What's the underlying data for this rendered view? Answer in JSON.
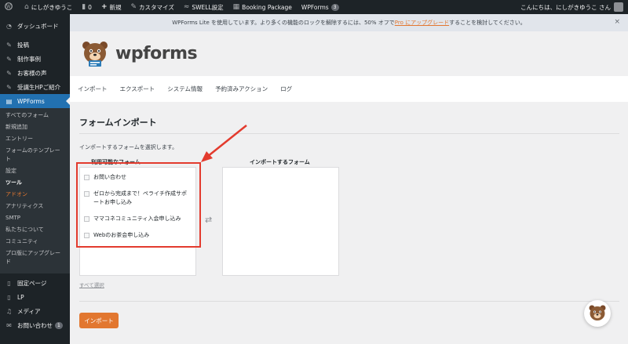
{
  "adminbar": {
    "site_name": "にしがきゆうこ",
    "comments_count": "0",
    "new_label": "新規",
    "customize_label": "カスタマイズ",
    "swell_label": "SWELL設定",
    "booking_label": "Booking Package",
    "wpforms_label": "WPForms",
    "wpforms_badge": "3",
    "greeting": "こんにちは、にしがきゆうこ さん"
  },
  "sidebar": {
    "items": [
      {
        "label": "ダッシュボード",
        "icon": "dashboard-icon"
      },
      {
        "label": "投稿",
        "icon": "pin-icon"
      },
      {
        "label": "制作事例",
        "icon": "pin-icon"
      },
      {
        "label": "お客様の声",
        "icon": "pin-icon"
      },
      {
        "label": "受講生HPご紹介",
        "icon": "pin-icon"
      },
      {
        "label": "WPForms",
        "icon": "forms-icon"
      }
    ],
    "submenu": [
      "すべてのフォーム",
      "新規追加",
      "エントリー",
      "フォームのテンプレート",
      "設定",
      "ツール",
      "アドオン",
      "アナリティクス",
      "SMTP",
      "私たちについて",
      "コミュニティ",
      "プロ版にアップグレード"
    ],
    "bottom_items": [
      {
        "label": "固定ページ",
        "icon": "page-icon"
      },
      {
        "label": "LP",
        "icon": "page-icon"
      },
      {
        "label": "メディア",
        "icon": "media-icon"
      },
      {
        "label": "お問い合わせ",
        "icon": "mail-icon",
        "badge": "1"
      }
    ]
  },
  "notice": {
    "text_before": "WPForms Lite を使用しています。より多くの機能のロックを解除するには、50% オフで",
    "link": "Pro にアップグレード",
    "text_after": "することを検討してください。",
    "close": "×"
  },
  "logo": {
    "text": "wpforms"
  },
  "tabs": [
    "インポート",
    "エクスポート",
    "システム情報",
    "予約済みアクション",
    "ログ"
  ],
  "page": {
    "title": "フォームインポート",
    "description": "インポートするフォームを選択します。",
    "available_label": "利用可能なフォーム",
    "import_label": "インポートするフォーム",
    "forms": [
      "お問い合わせ",
      "ゼロから完成まで！ペライチ作成サポートお申し込み",
      "ママコネコミュニティ入会申し込み",
      "Webのお茶会申し込み"
    ],
    "select_all": "すべて選択",
    "import_button": "インポート"
  },
  "colors": {
    "accent": "#e27730",
    "highlight": "#e33b2e",
    "admin_dark": "#1d2327",
    "active_blue": "#2271b1"
  }
}
